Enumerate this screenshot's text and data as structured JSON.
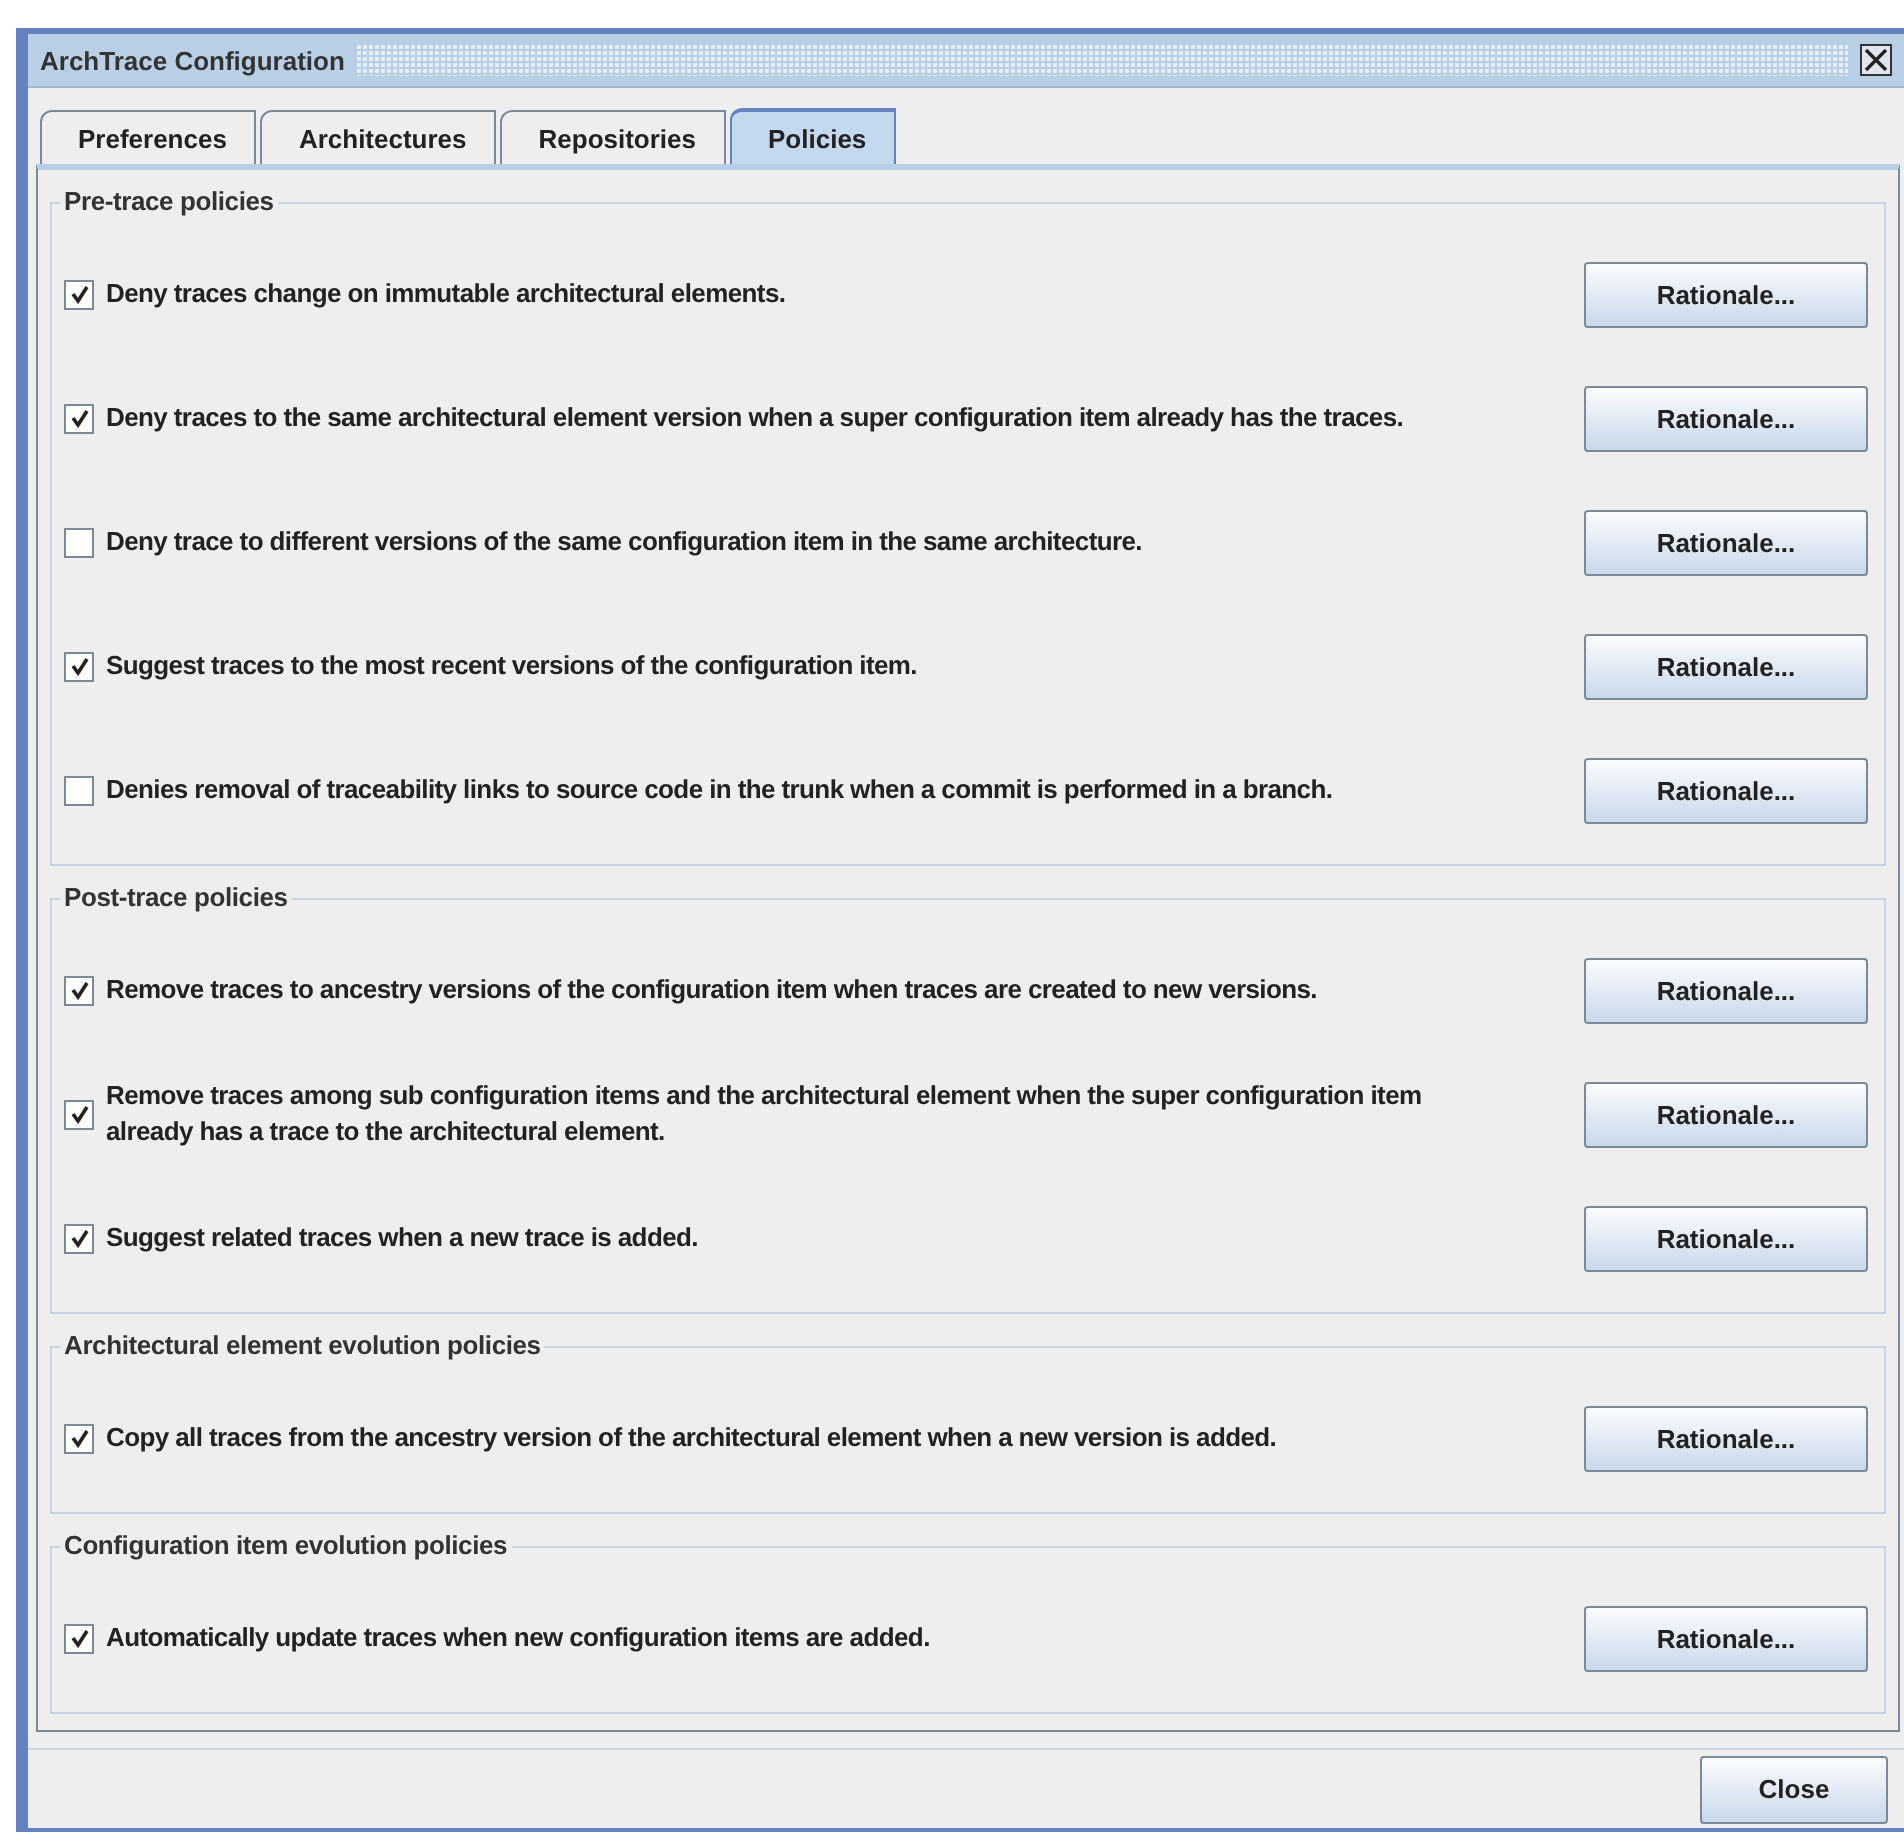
{
  "window": {
    "title": "ArchTrace Configuration"
  },
  "tabs": [
    {
      "label": "Preferences",
      "selected": false
    },
    {
      "label": "Architectures",
      "selected": false
    },
    {
      "label": "Repositories",
      "selected": false
    },
    {
      "label": "Policies",
      "selected": true
    }
  ],
  "groups": [
    {
      "title": "Pre-trace policies",
      "policies": [
        {
          "text": "Deny traces change on immutable architectural elements.",
          "checked": true,
          "button": "Rationale..."
        },
        {
          "text": "Deny traces to the same architectural element version when a super configuration item already has the traces.",
          "checked": true,
          "button": "Rationale..."
        },
        {
          "text": "Deny trace to different versions of the same configuration item in the same architecture.",
          "checked": false,
          "button": "Rationale..."
        },
        {
          "text": "Suggest traces to the most recent versions of the configuration item.",
          "checked": true,
          "button": "Rationale..."
        },
        {
          "text": "Denies removal of traceability links to source code in the trunk when a commit is performed in a branch.",
          "checked": false,
          "button": "Rationale..."
        }
      ]
    },
    {
      "title": "Post-trace policies",
      "policies": [
        {
          "text": "Remove traces to ancestry versions of the configuration item when traces are created to new versions.",
          "checked": true,
          "button": "Rationale..."
        },
        {
          "text": "Remove traces among sub configuration items and the architectural element when the super configuration item already has a trace to the architectural element.",
          "checked": true,
          "button": "Rationale..."
        },
        {
          "text": "Suggest related traces when a new trace is added.",
          "checked": true,
          "button": "Rationale..."
        }
      ]
    },
    {
      "title": "Architectural element evolution policies",
      "policies": [
        {
          "text": "Copy all traces from the ancestry version of the architectural element when a new version is added.",
          "checked": true,
          "button": "Rationale..."
        }
      ]
    },
    {
      "title": "Configuration item evolution policies",
      "policies": [
        {
          "text": "Automatically update traces when new configuration items are added.",
          "checked": true,
          "button": "Rationale..."
        }
      ]
    }
  ],
  "close_button": "Close"
}
